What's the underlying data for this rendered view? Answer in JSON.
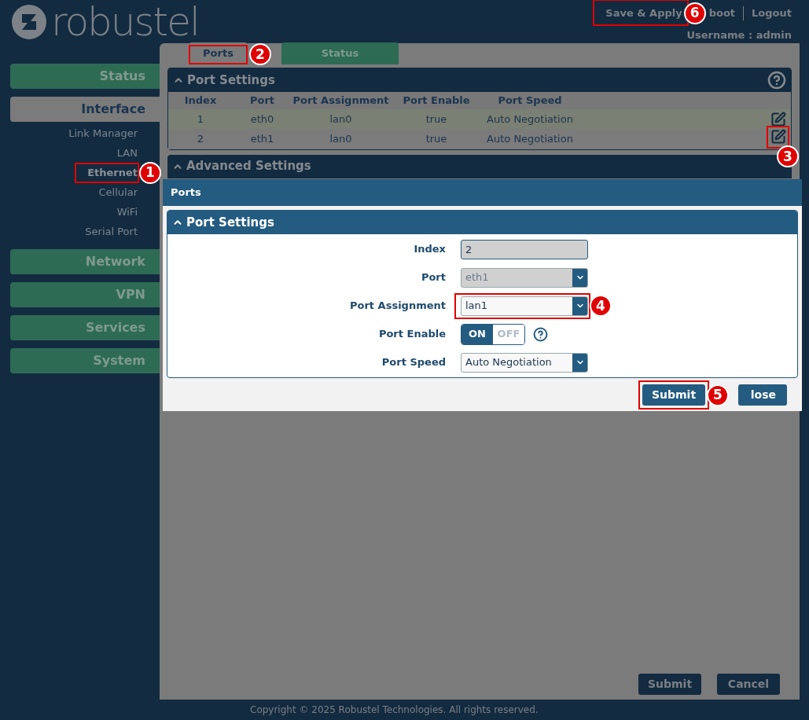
{
  "header": {
    "brand": "robustel",
    "links": [
      {
        "label": "Save & Apply",
        "callout": "6"
      },
      {
        "label": "boot"
      },
      {
        "label": "Logout"
      }
    ],
    "username": "Username : admin"
  },
  "sidebar": {
    "items": [
      {
        "label": "Status",
        "expanded": false
      },
      {
        "label": "Interface",
        "expanded": true,
        "children": [
          {
            "label": "Link Manager",
            "selected": false
          },
          {
            "label": "LAN",
            "selected": false
          },
          {
            "label": "Ethernet",
            "selected": true,
            "callout": "1"
          },
          {
            "label": "Cellular",
            "selected": false
          },
          {
            "label": "WiFi",
            "selected": false
          },
          {
            "label": "Serial Port",
            "selected": false
          }
        ]
      },
      {
        "label": "Network",
        "expanded": false
      },
      {
        "label": "VPN",
        "expanded": false
      },
      {
        "label": "Services",
        "expanded": false
      },
      {
        "label": "System",
        "expanded": false
      }
    ]
  },
  "tabs": [
    {
      "label": "Ports",
      "selected": true,
      "callout": "2"
    },
    {
      "label": "Status",
      "selected": false
    }
  ],
  "port_settings": {
    "title": "Port Settings",
    "columns": [
      "Index",
      "Port",
      "Port Assignment",
      "Port Enable",
      "Port Speed"
    ],
    "rows": [
      {
        "cells": [
          "1",
          "eth0",
          "lan0",
          "true",
          "Auto Negotiation"
        ]
      },
      {
        "cells": [
          "2",
          "eth1",
          "lan0",
          "true",
          "Auto Negotiation"
        ],
        "callout": "3"
      }
    ]
  },
  "advanced_settings": {
    "title": "Advanced Settings"
  },
  "buttons": [
    {
      "label": "Submit"
    },
    {
      "label": "Cancel"
    }
  ],
  "footer": "Copyright © 2025 Robustel Technologies. All rights reserved.",
  "dialog": {
    "title": "Ports",
    "section": "Port Settings",
    "fields": [
      {
        "kind": "text",
        "label": "Index",
        "value": "2",
        "disabled": true
      },
      {
        "kind": "select",
        "label": "Port",
        "value": "eth1",
        "disabled": true
      },
      {
        "kind": "select",
        "label": "Port Assignment",
        "value": "lan1",
        "disabled": false,
        "callout": "4"
      },
      {
        "kind": "toggle",
        "label": "Port Enable",
        "on": true,
        "on_label": "ON",
        "off_label": "OFF"
      },
      {
        "kind": "select",
        "label": "Port Speed",
        "value": "Auto Negotiation",
        "disabled": false
      }
    ],
    "buttons": [
      {
        "label": "Submit",
        "callout": "5"
      },
      {
        "label": "lose"
      }
    ]
  }
}
